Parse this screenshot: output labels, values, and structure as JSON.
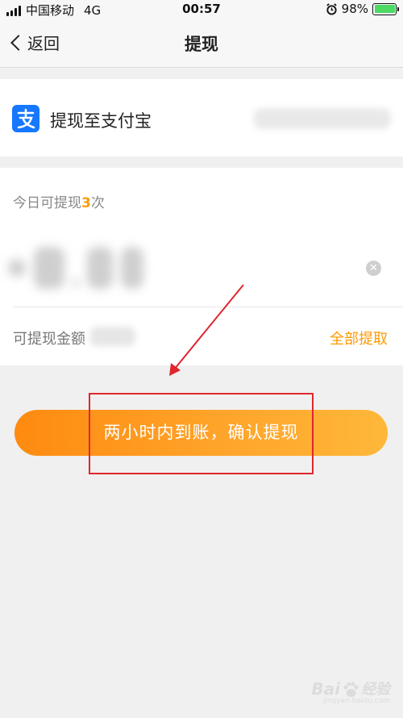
{
  "status_bar": {
    "carrier": "中国移动",
    "network": "4G",
    "time": "00:57",
    "battery": "98%",
    "icons": [
      "signal-icon",
      "alarm-icon",
      "battery-charging-icon"
    ]
  },
  "nav": {
    "back_label": "返回",
    "title": "提现"
  },
  "destination": {
    "label": "提现至支付宝",
    "icon": "alipay-icon",
    "brand_color": "#1677ff"
  },
  "amount": {
    "limit_prefix": "今日可提现",
    "limit_count": "3",
    "limit_suffix": "次",
    "available_label": "可提现金额",
    "withdraw_all_label": "全部提取",
    "accent_color": "#ff9a00"
  },
  "confirm_button": {
    "label": "两小时内到账，确认提现"
  },
  "watermark": {
    "text": "Bai",
    "text2": "经验",
    "sub": "jingyan.baidu.com"
  }
}
